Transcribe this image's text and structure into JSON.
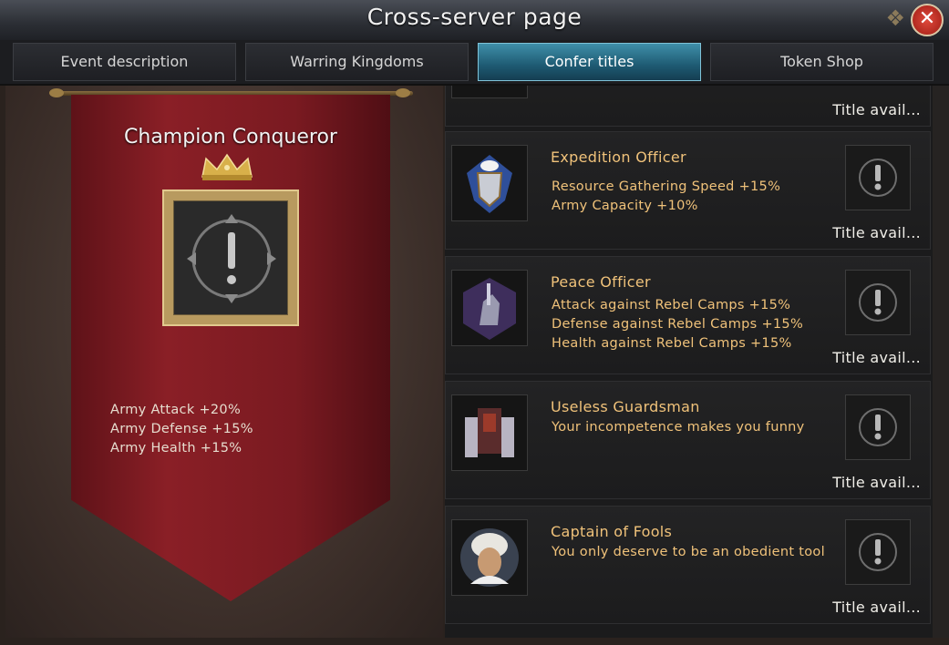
{
  "header": {
    "title": "Cross-server page",
    "close_icon": "close-icon"
  },
  "tabs": [
    {
      "label": "Event description",
      "active": false
    },
    {
      "label": "Warring Kingdoms",
      "active": false
    },
    {
      "label": "Confer titles",
      "active": true
    },
    {
      "label": "Token Shop",
      "active": false
    }
  ],
  "featured_title": {
    "name": "Champion Conqueror",
    "stats": [
      "Army Attack +20%",
      "Army Defense +15%",
      "Army Health +15%"
    ]
  },
  "titles": [
    {
      "name": "",
      "desc": [],
      "status": "Title avail...",
      "icon": "partial-icon"
    },
    {
      "name": "Expedition Officer",
      "desc": [
        "Resource Gathering Speed +15%",
        "Army Capacity +10%"
      ],
      "status": "Title avail...",
      "icon": "shield-dove-icon"
    },
    {
      "name": "Peace Officer",
      "desc": [
        "Attack against Rebel Camps +15%",
        "Defense against Rebel Camps +15%",
        "Health against Rebel Camps +15%"
      ],
      "status": "Title avail...",
      "icon": "knight-icon"
    },
    {
      "name": "Useless Guardsman",
      "desc": [
        "Your incompetence makes you funny"
      ],
      "status": "Title avail...",
      "icon": "castle-gate-icon"
    },
    {
      "name": "Captain of Fools",
      "desc": [
        "You only deserve to be an obedient tool"
      ],
      "status": "Title avail...",
      "icon": "turban-portrait-icon"
    }
  ],
  "colors": {
    "accent": "#f0c27a",
    "tab_active": "#2a7594",
    "banner": "#7a1a21"
  }
}
